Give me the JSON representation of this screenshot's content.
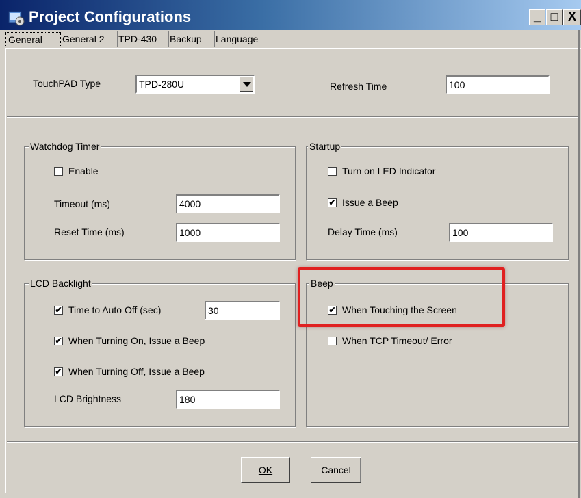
{
  "window": {
    "title": "Project Configurations",
    "controls": {
      "minimize": "_",
      "maximize": "□",
      "close": "X"
    }
  },
  "tabs": [
    {
      "label": "General",
      "active": true
    },
    {
      "label": "General 2"
    },
    {
      "label": "TPD-430"
    },
    {
      "label": "Backup"
    },
    {
      "label": "Language"
    }
  ],
  "general": {
    "touchpad_type_label": "TouchPAD Type",
    "touchpad_type_value": "TPD-280U",
    "refresh_time_label": "Refresh Time",
    "refresh_time_value": "100"
  },
  "watchdog": {
    "title": "Watchdog Timer",
    "enable_label": "Enable",
    "enable_checked": false,
    "timeout_label": "Timeout (ms)",
    "timeout_value": "4000",
    "reset_label": "Reset Time (ms)",
    "reset_value": "1000"
  },
  "startup": {
    "title": "Startup",
    "led_label": "Turn on LED Indicator",
    "led_checked": false,
    "beep_label": "Issue a Beep",
    "beep_checked": true,
    "delay_label": "Delay Time (ms)",
    "delay_value": "100"
  },
  "lcd": {
    "title": "LCD Backlight",
    "auto_off_label": "Time to Auto Off (sec)",
    "auto_off_checked": true,
    "auto_off_value": "30",
    "turn_on_label": "When Turning On, Issue a Beep",
    "turn_on_checked": true,
    "turn_off_label": "When Turning Off, Issue a Beep",
    "turn_off_checked": true,
    "brightness_label": "LCD Brightness",
    "brightness_value": "180"
  },
  "beep": {
    "title": "Beep",
    "touch_label": "When Touching the Screen",
    "touch_checked": true,
    "tcp_label": "When TCP Timeout/ Error",
    "tcp_checked": false
  },
  "buttons": {
    "ok_label": "OK",
    "cancel_label": "Cancel"
  },
  "colors": {
    "highlight": "#e02020",
    "dialog_bg": "#d4d0c8"
  },
  "icons": {
    "app": "project-config-icon",
    "checkmark": "✔"
  }
}
